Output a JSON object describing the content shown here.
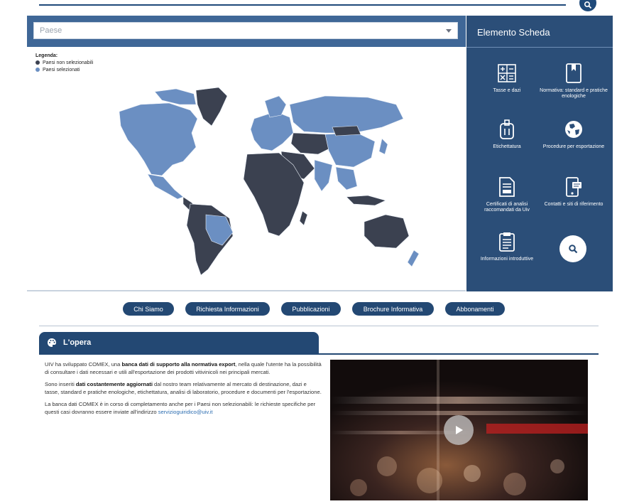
{
  "colors": {
    "primary": "#234873",
    "map_header": "#3f6797",
    "side_panel": "#2b4e78",
    "country_selected": "#6b8fc2",
    "country_unselected": "#3b4150"
  },
  "search": {
    "icon": "search-icon"
  },
  "map": {
    "select_placeholder": "Paese",
    "legend": {
      "title": "Legenda:",
      "items": [
        {
          "label": "Paesi non selezionabili",
          "color": "#3b4150"
        },
        {
          "label": "Paesi selezionati",
          "color": "#6b8fc2"
        }
      ]
    }
  },
  "side_panel": {
    "title": "Elemento Scheda",
    "tiles": [
      {
        "label": "Tasse e dazi",
        "icon": "calculator-icon"
      },
      {
        "label": "Normativa: standard e pratiche enologiche",
        "icon": "book-icon"
      },
      {
        "label": "Etichettatura",
        "icon": "label-icon"
      },
      {
        "label": "Procedure per esportazione",
        "icon": "globe-icon"
      },
      {
        "label": "Certificati di analisi raccomandati da Uiv",
        "icon": "certificate-icon"
      },
      {
        "label": "Contatti e siti di riferimento",
        "icon": "contact-phone-icon"
      },
      {
        "label": "Informazioni introduttive",
        "icon": "clipboard-icon"
      }
    ],
    "search_icon": "search-icon"
  },
  "nav": [
    {
      "label": "Chi Siamo"
    },
    {
      "label": "Richiesta Informazioni"
    },
    {
      "label": "Pubblicazioni"
    },
    {
      "label": "Brochure Informativa"
    },
    {
      "label": "Abbonamenti"
    }
  ],
  "opera": {
    "title": "L'opera",
    "icon": "palette-icon",
    "p1_a": "UIV ha sviluppato COMEX, una ",
    "p1_b": "banca dati di supporto alla normativa export",
    "p1_c": ", nella quale l'utente ha la possibilità di consultare i dati necessari e utili all'esportazione dei prodotti vitivinicoli nei principali mercati.",
    "p2_a": "Sono inseriti ",
    "p2_b": "dati costantemente aggiornati",
    "p2_c": " dal nostro team relativamente al mercato di destinazione, dazi e tasse, standard e pratiche enologiche, etichettatura, analisi di laboratorio, procedure e documenti per l'esportazione.",
    "p3_a": "La banca dati COMEX è in corso di completamento anche per i Paesi non selezionabili: le richieste specifiche per questi casi dovranno essere inviate all'indirizzo ",
    "p3_link": "servizioguiridico@uiv.it"
  },
  "video": {
    "icon": "play-icon"
  }
}
